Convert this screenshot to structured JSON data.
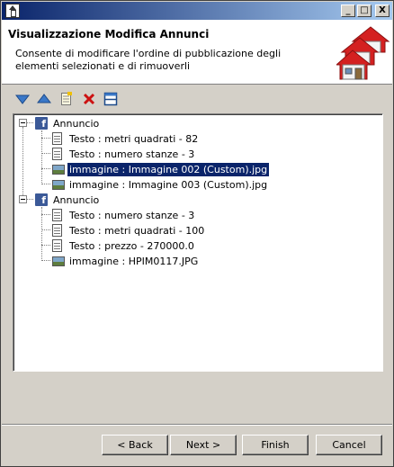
{
  "window": {
    "controls": {
      "minimize": "_",
      "maximize": "□",
      "close": "X"
    }
  },
  "header": {
    "title": "Visualizzazione Modifica Annunci",
    "description": "Consente di modificare l'ordine di pubblicazione degli elementi selezionati e di rimuoverli"
  },
  "toolbar": {
    "icons": [
      "move-down-icon",
      "move-up-icon",
      "document-icon",
      "delete-icon",
      "split-icon"
    ]
  },
  "tree": {
    "groups": [
      {
        "label": "Annuncio",
        "items": [
          {
            "type": "text",
            "label": "Testo : metri quadrati - 82"
          },
          {
            "type": "text",
            "label": "Testo : numero stanze - 3"
          },
          {
            "type": "image",
            "label": "immagine : Immagine 002 (Custom).jpg",
            "selected": true
          },
          {
            "type": "image",
            "label": "immagine : Immagine 003 (Custom).jpg"
          }
        ]
      },
      {
        "label": "Annuncio",
        "items": [
          {
            "type": "text",
            "label": "Testo : numero stanze - 3"
          },
          {
            "type": "text",
            "label": "Testo : metri quadrati - 100"
          },
          {
            "type": "text",
            "label": "Testo : prezzo - 270000.0"
          },
          {
            "type": "image",
            "label": "immagine : HPIM0117.JPG"
          }
        ]
      }
    ]
  },
  "buttons": {
    "back": "< Back",
    "next": "Next >",
    "finish": "Finish",
    "cancel": "Cancel"
  },
  "colors": {
    "selection": "#0a246a",
    "facebook": "#3b5998",
    "delete": "#cc1111",
    "logo_roof": "#d42020"
  }
}
